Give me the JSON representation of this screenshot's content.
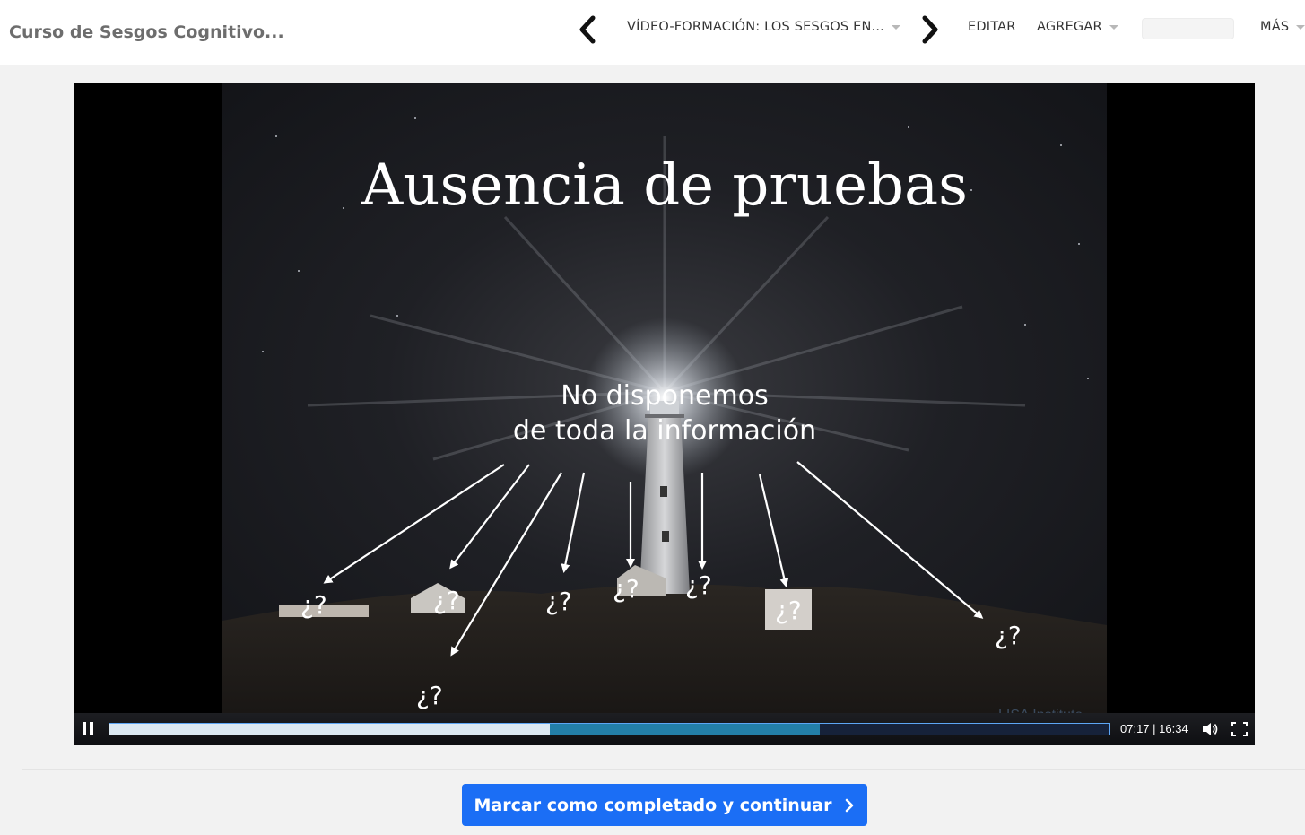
{
  "header": {
    "course_title": "Curso de Sesgos Cognitivo...",
    "lesson_title": "VÍDEO-FORMACIÓN: LOS SESGOS EN...",
    "edit_label": "EDITAR",
    "add_label": "AGREGAR",
    "more_label": "MÁS"
  },
  "slide": {
    "title": "Ausencia de pruebas",
    "subtitle_line1": "No disponemos",
    "subtitle_line2": "de toda la información",
    "question_mark": "¿?"
  },
  "player": {
    "state": "playing",
    "time_display": "07:17 | 16:34",
    "current_time": "07:17",
    "duration": "16:34",
    "played_fraction": 0.44,
    "buffered_fraction": 0.71
  },
  "footer": {
    "complete_button_label": "Marcar como completado y continuar"
  },
  "colors": {
    "primary_button": "#1b6ef5",
    "progress_played": "#dce9f2",
    "progress_buffered": "#237fa8",
    "progress_border": "#5da6f5"
  },
  "icons": [
    "prev-arrow-icon",
    "next-arrow-icon",
    "caret-down-icon",
    "pause-icon",
    "volume-icon",
    "fullscreen-icon",
    "chevron-right-icon"
  ]
}
